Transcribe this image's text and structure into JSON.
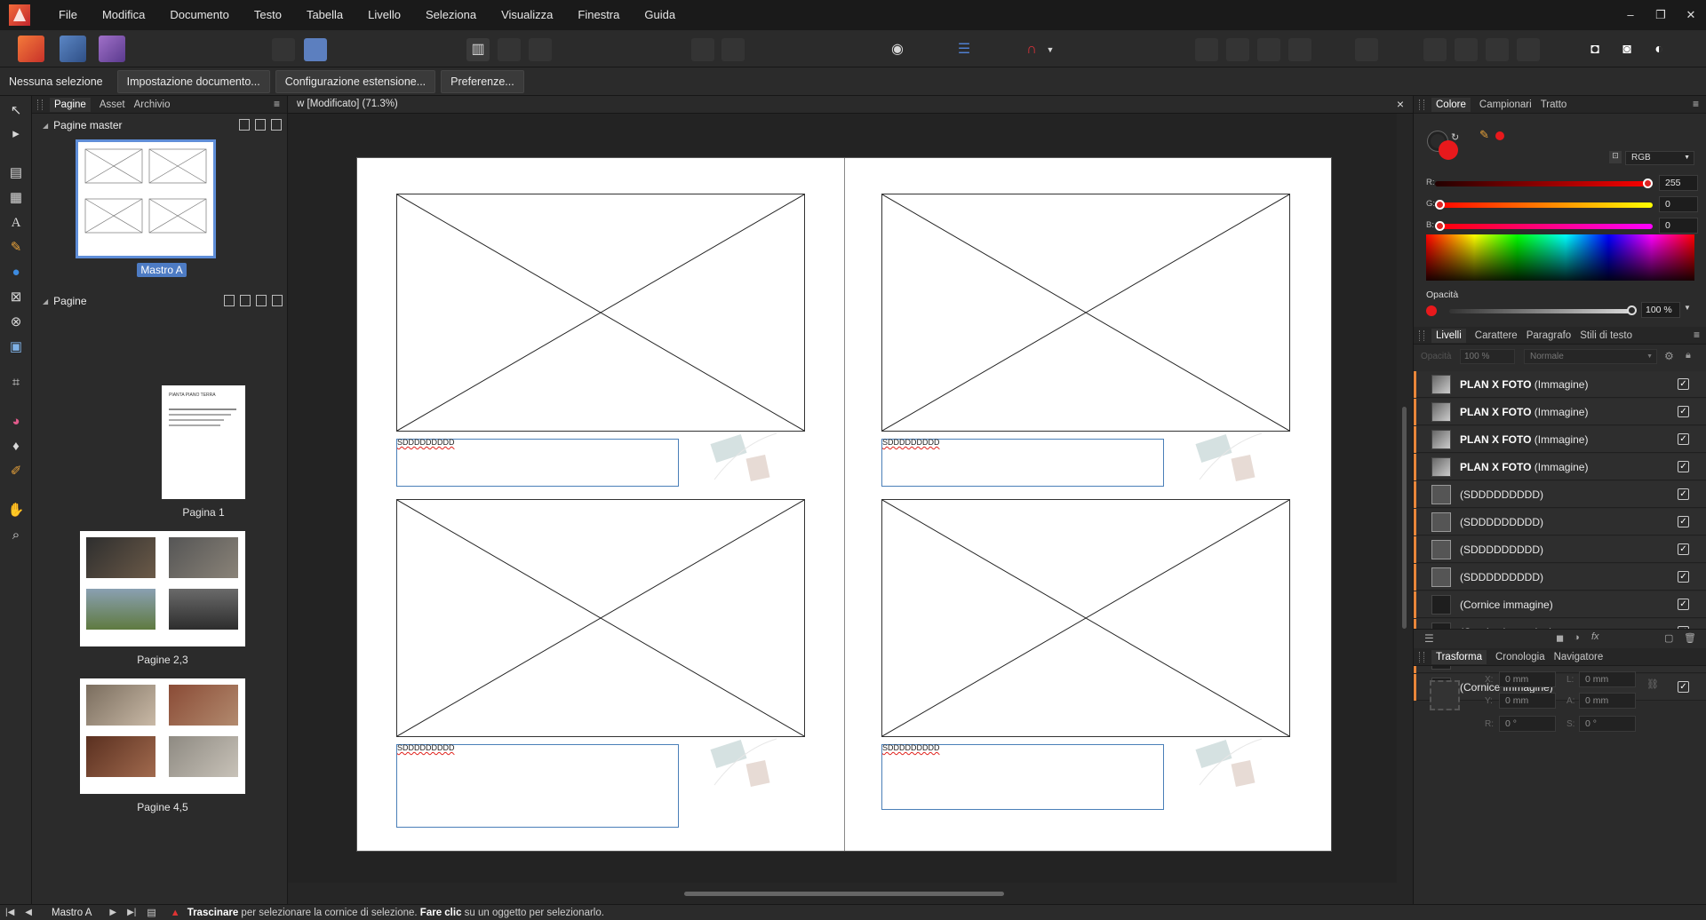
{
  "menubar": {
    "items": [
      "File",
      "Modifica",
      "Documento",
      "Testo",
      "Tabella",
      "Livello",
      "Seleziona",
      "Visualizza",
      "Finestra",
      "Guida"
    ],
    "window_controls": [
      "–",
      "❐",
      "✕"
    ]
  },
  "contextbar": {
    "selection_label": "Nessuna selezione",
    "buttons": [
      "Impostazione documento...",
      "Configurazione estensione...",
      "Preferenze..."
    ]
  },
  "left_panel": {
    "tabs": [
      "Pagine",
      "Asset",
      "Archivio"
    ],
    "master_section": "Pagine master",
    "master_label": "Mastro A",
    "pages_section": "Pagine",
    "page_labels": [
      "Pagina 1",
      "Pagine 2,3",
      "Pagine 4,5"
    ],
    "page1_header": "PIANTA PIANO TERRA"
  },
  "document": {
    "tab_title": "w [Modificato] (71.3%)",
    "caption_text": "SDDDDDDDDD"
  },
  "color_panel": {
    "tabs": [
      "Colore",
      "Campionari",
      "Tratto"
    ],
    "model": "RGB",
    "channels": [
      {
        "label": "R:",
        "value": "255",
        "level": 1.0
      },
      {
        "label": "G:",
        "value": "0",
        "level": 0.0
      },
      {
        "label": "B:",
        "value": "0",
        "level": 0.0
      }
    ],
    "opacity_label": "Opacità",
    "opacity_value": "100 %",
    "current_color": "#e8191c"
  },
  "layers_panel": {
    "tabs": [
      "Livelli",
      "Carattere",
      "Paragrafo",
      "Stili di testo"
    ],
    "opacity_label": "Opacità",
    "opacity_value": "100 %",
    "blend_mode": "Normale",
    "layers": [
      {
        "name": "PLAN X FOTO",
        "type": "(Immagine)",
        "kind": "image"
      },
      {
        "name": "PLAN X FOTO",
        "type": "(Immagine)",
        "kind": "image"
      },
      {
        "name": "PLAN X FOTO",
        "type": "(Immagine)",
        "kind": "image"
      },
      {
        "name": "PLAN X FOTO",
        "type": "(Immagine)",
        "kind": "image"
      },
      {
        "name": "",
        "type": "(SDDDDDDDDD)",
        "kind": "text"
      },
      {
        "name": "",
        "type": "(SDDDDDDDDD)",
        "kind": "text"
      },
      {
        "name": "",
        "type": "(SDDDDDDDDD)",
        "kind": "text"
      },
      {
        "name": "",
        "type": "(SDDDDDDDDD)",
        "kind": "text"
      },
      {
        "name": "",
        "type": "(Cornice immagine)",
        "kind": "frame"
      },
      {
        "name": "",
        "type": "(Cornice immagine)",
        "kind": "frame"
      },
      {
        "name": "",
        "type": "(Cornice immagine)",
        "kind": "frame"
      },
      {
        "name": "",
        "type": "(Cornice immagine)",
        "kind": "frame"
      }
    ]
  },
  "transform_panel": {
    "tabs": [
      "Trasforma",
      "Cronologia",
      "Navigatore"
    ],
    "x_label": "X:",
    "y_label": "Y:",
    "w_label": "L:",
    "h_label": "A:",
    "r_label": "R:",
    "s_label": "S:",
    "x": "0 mm",
    "y": "0 mm",
    "w": "0 mm",
    "h": "0 mm",
    "r": "0 °",
    "s": "0 °"
  },
  "statusbar": {
    "nav_first": "|◀",
    "nav_prev": "◀",
    "master": "Mastro A",
    "nav_next": "▶",
    "nav_last": "▶|",
    "hint_bold1": "Trascinare",
    "hint_mid": " per selezionare la cornice di selezione. ",
    "hint_bold2": "Fare clic",
    "hint_end": " su un oggetto per selezionarlo."
  }
}
